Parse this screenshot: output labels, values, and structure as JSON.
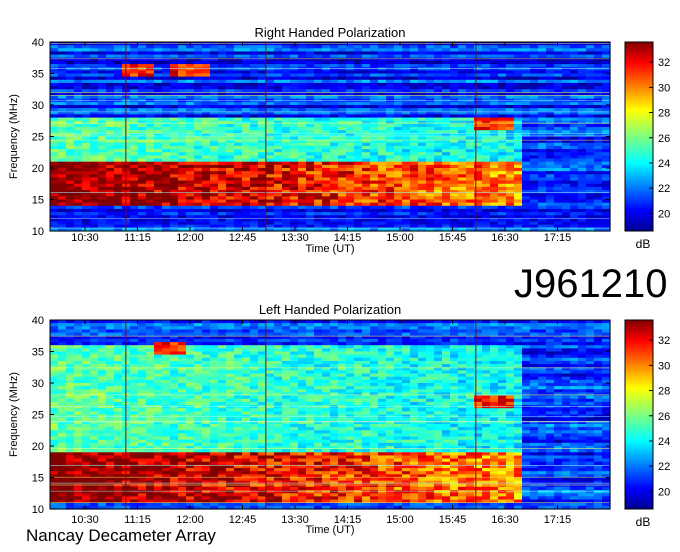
{
  "page": {
    "observation_id": "J961210",
    "instrument": "Nancay Decameter Array"
  },
  "chart_data": [
    {
      "type": "heatmap",
      "title": "Right Handed Polarization",
      "xlabel": "Time (UT)",
      "ylabel": "Frequency (MHz)",
      "x_ticks": [
        "10:30",
        "11:15",
        "12:00",
        "12:45",
        "13:30",
        "14:15",
        "15:00",
        "15:45",
        "16:30",
        "17:15"
      ],
      "y_ticks": [
        10,
        15,
        20,
        25,
        30,
        35,
        40
      ],
      "ylim": [
        10,
        40
      ],
      "xlim": [
        "10:00",
        "18:00"
      ],
      "colorbar": {
        "label": "dB",
        "ticks": [
          20,
          22,
          24,
          26,
          28,
          30,
          32
        ],
        "range": [
          18.6,
          33.6
        ]
      },
      "features": {
        "strong_band_mhz": [
          14,
          21
        ],
        "weak_band_mhz": [
          21,
          28
        ],
        "emission_end_time": "16:45",
        "bright_patches": [
          {
            "time": "11:15",
            "freq_mhz": 35.5
          },
          {
            "time": "12:00",
            "freq_mhz": 35.5
          },
          {
            "time": "16:20",
            "freq_mhz": 27
          }
        ]
      }
    },
    {
      "type": "heatmap",
      "title": "Left Handed Polarization",
      "xlabel": "Time (UT)",
      "ylabel": "Frequency (MHz)",
      "x_ticks": [
        "10:30",
        "11:15",
        "12:00",
        "12:45",
        "13:30",
        "14:15",
        "15:00",
        "15:45",
        "16:30",
        "17:15"
      ],
      "y_ticks": [
        10,
        15,
        20,
        25,
        30,
        35,
        40
      ],
      "ylim": [
        10,
        40
      ],
      "xlim": [
        "10:00",
        "18:00"
      ],
      "colorbar": {
        "label": "dB",
        "ticks": [
          20,
          22,
          24,
          26,
          28,
          30,
          32
        ],
        "range": [
          18.6,
          33.6
        ]
      },
      "features": {
        "strong_band_mhz": [
          11,
          19
        ],
        "weak_band_mhz": [
          19,
          36
        ],
        "emission_end_time": "16:45",
        "bright_patches": [
          {
            "time": "11:45",
            "freq_mhz": 35.5
          },
          {
            "time": "16:20",
            "freq_mhz": 27
          }
        ]
      }
    }
  ]
}
